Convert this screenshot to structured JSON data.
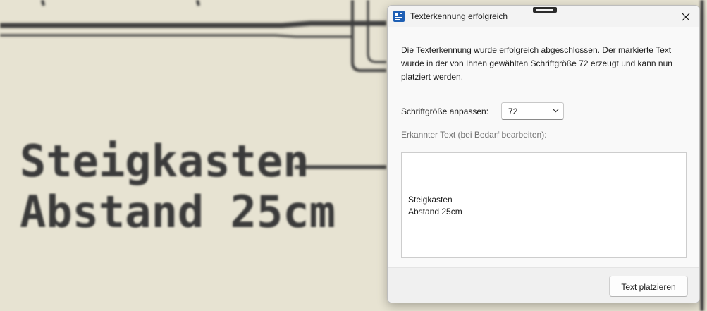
{
  "background": {
    "ocr_line_1": "Steigkasten",
    "ocr_line_2": "Abstand 25cm"
  },
  "dialog": {
    "title": "Texterkennung erfolgreich",
    "message": "Die Texterkennung wurde erfolgreich abgeschlossen. Der markierte Text wurde in der von Ihnen gewählten Schriftgröße 72 erzeugt und kann nun platziert werden.",
    "font_size_label": "Schriftgröße anpassen:",
    "font_size_value": "72",
    "recognized_label": "Erkannter Text (bei Bedarf bearbeiten):",
    "recognized_text": "Steigkasten\nAbstand 25cm",
    "place_button": "Text platzieren",
    "icons": {
      "app": "ocr-app-icon",
      "close": "close-icon",
      "dropdown": "chevron-down-icon"
    }
  },
  "colors": {
    "background_paper": "#e7e3d2",
    "drawing_ink": "#3c3c3c",
    "app_icon": "#1e5fb4"
  }
}
